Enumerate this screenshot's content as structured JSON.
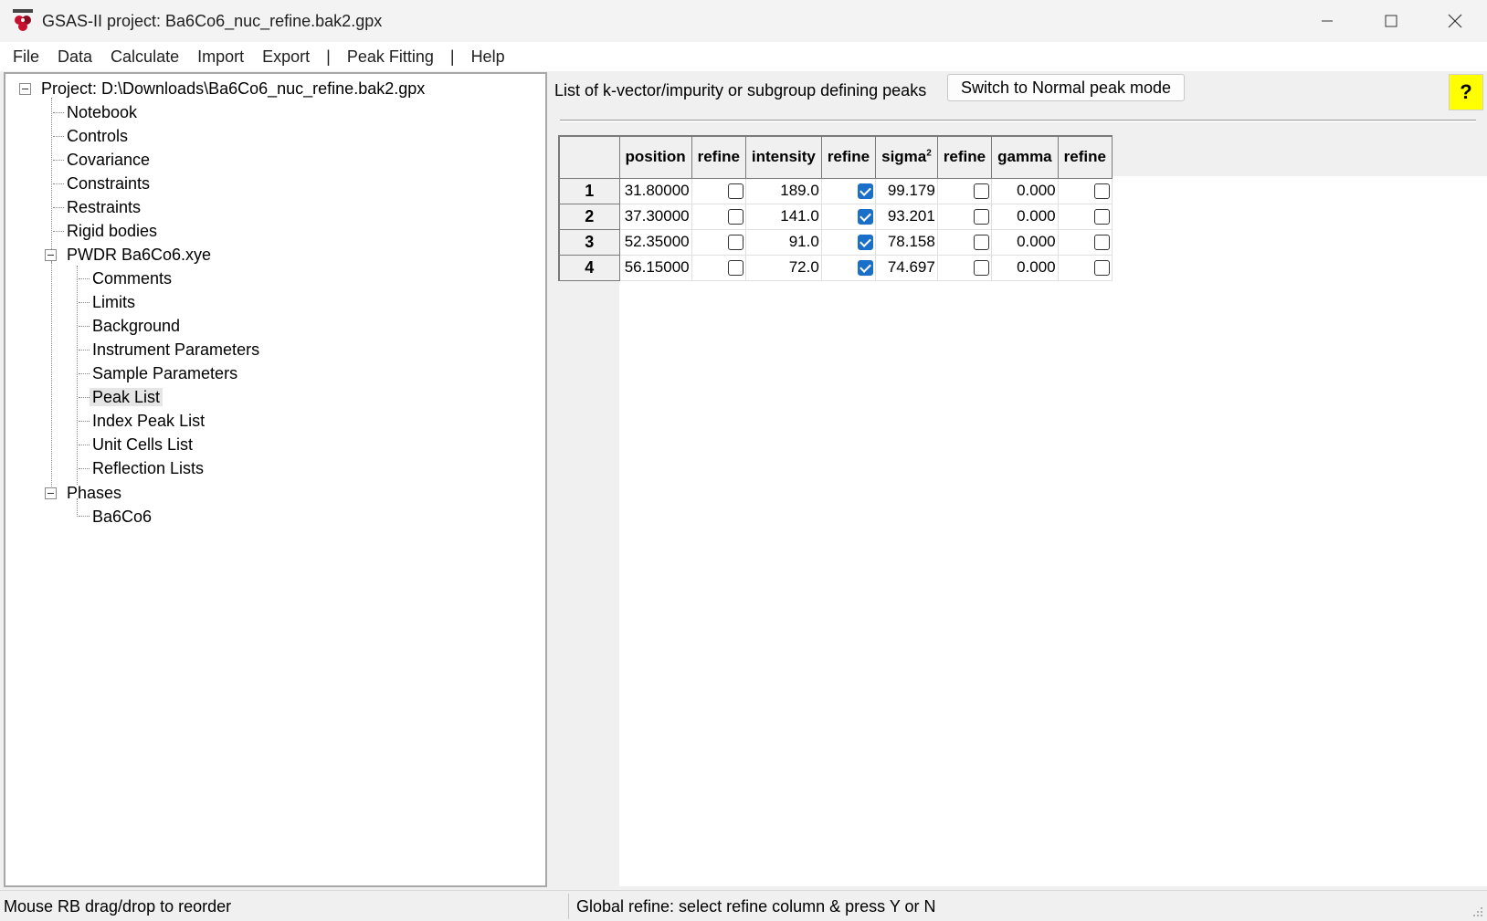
{
  "window": {
    "title": "GSAS-II project: Ba6Co6_nuc_refine.bak2.gpx",
    "app_icon": "gsas-logo-icon"
  },
  "menu": [
    "File",
    "Data",
    "Calculate",
    "Import",
    "Export",
    "|",
    "Peak Fitting",
    "|",
    "Help"
  ],
  "tree": {
    "root": "Project: D:\\Downloads\\Ba6Co6_nuc_refine.bak2.gpx",
    "items": [
      "Notebook",
      "Controls",
      "Covariance",
      "Constraints",
      "Restraints",
      "Rigid bodies"
    ],
    "pwdr": {
      "label": "PWDR Ba6Co6.xye",
      "children": [
        "Comments",
        "Limits",
        "Background",
        "Instrument Parameters",
        "Sample Parameters",
        "Peak List",
        "Index Peak List",
        "Unit Cells List",
        "Reflection Lists"
      ],
      "selected": "Peak List"
    },
    "phases": {
      "label": "Phases",
      "children": [
        "Ba6Co6"
      ]
    }
  },
  "right": {
    "header": "List of k-vector/impurity or subgroup defining peaks",
    "switch_button": "Switch to Normal peak mode",
    "help_button": "?"
  },
  "table": {
    "columns": [
      "position",
      "refine",
      "intensity",
      "refine",
      "sigma",
      "refine",
      "gamma",
      "refine"
    ],
    "sigma_superscript": "2",
    "rows": [
      {
        "num": "1",
        "position": "31.80000",
        "pos_refine": false,
        "intensity": "189.0",
        "int_refine": true,
        "sigma": "99.179",
        "sig_refine": false,
        "gamma": "0.000",
        "gam_refine": false
      },
      {
        "num": "2",
        "position": "37.30000",
        "pos_refine": false,
        "intensity": "141.0",
        "int_refine": true,
        "sigma": "93.201",
        "sig_refine": false,
        "gamma": "0.000",
        "gam_refine": false
      },
      {
        "num": "3",
        "position": "52.35000",
        "pos_refine": false,
        "intensity": "91.0",
        "int_refine": true,
        "sigma": "78.158",
        "sig_refine": false,
        "gamma": "0.000",
        "gam_refine": false
      },
      {
        "num": "4",
        "position": "56.15000",
        "pos_refine": false,
        "intensity": "72.0",
        "int_refine": true,
        "sigma": "74.697",
        "sig_refine": false,
        "gamma": "0.000",
        "gam_refine": false
      }
    ]
  },
  "status": {
    "left": "Mouse RB drag/drop to reorder",
    "right": "Global refine: select refine column & press Y or N"
  },
  "colors": {
    "accent": "#1a6fc9",
    "help_bg": "#ffff00"
  }
}
